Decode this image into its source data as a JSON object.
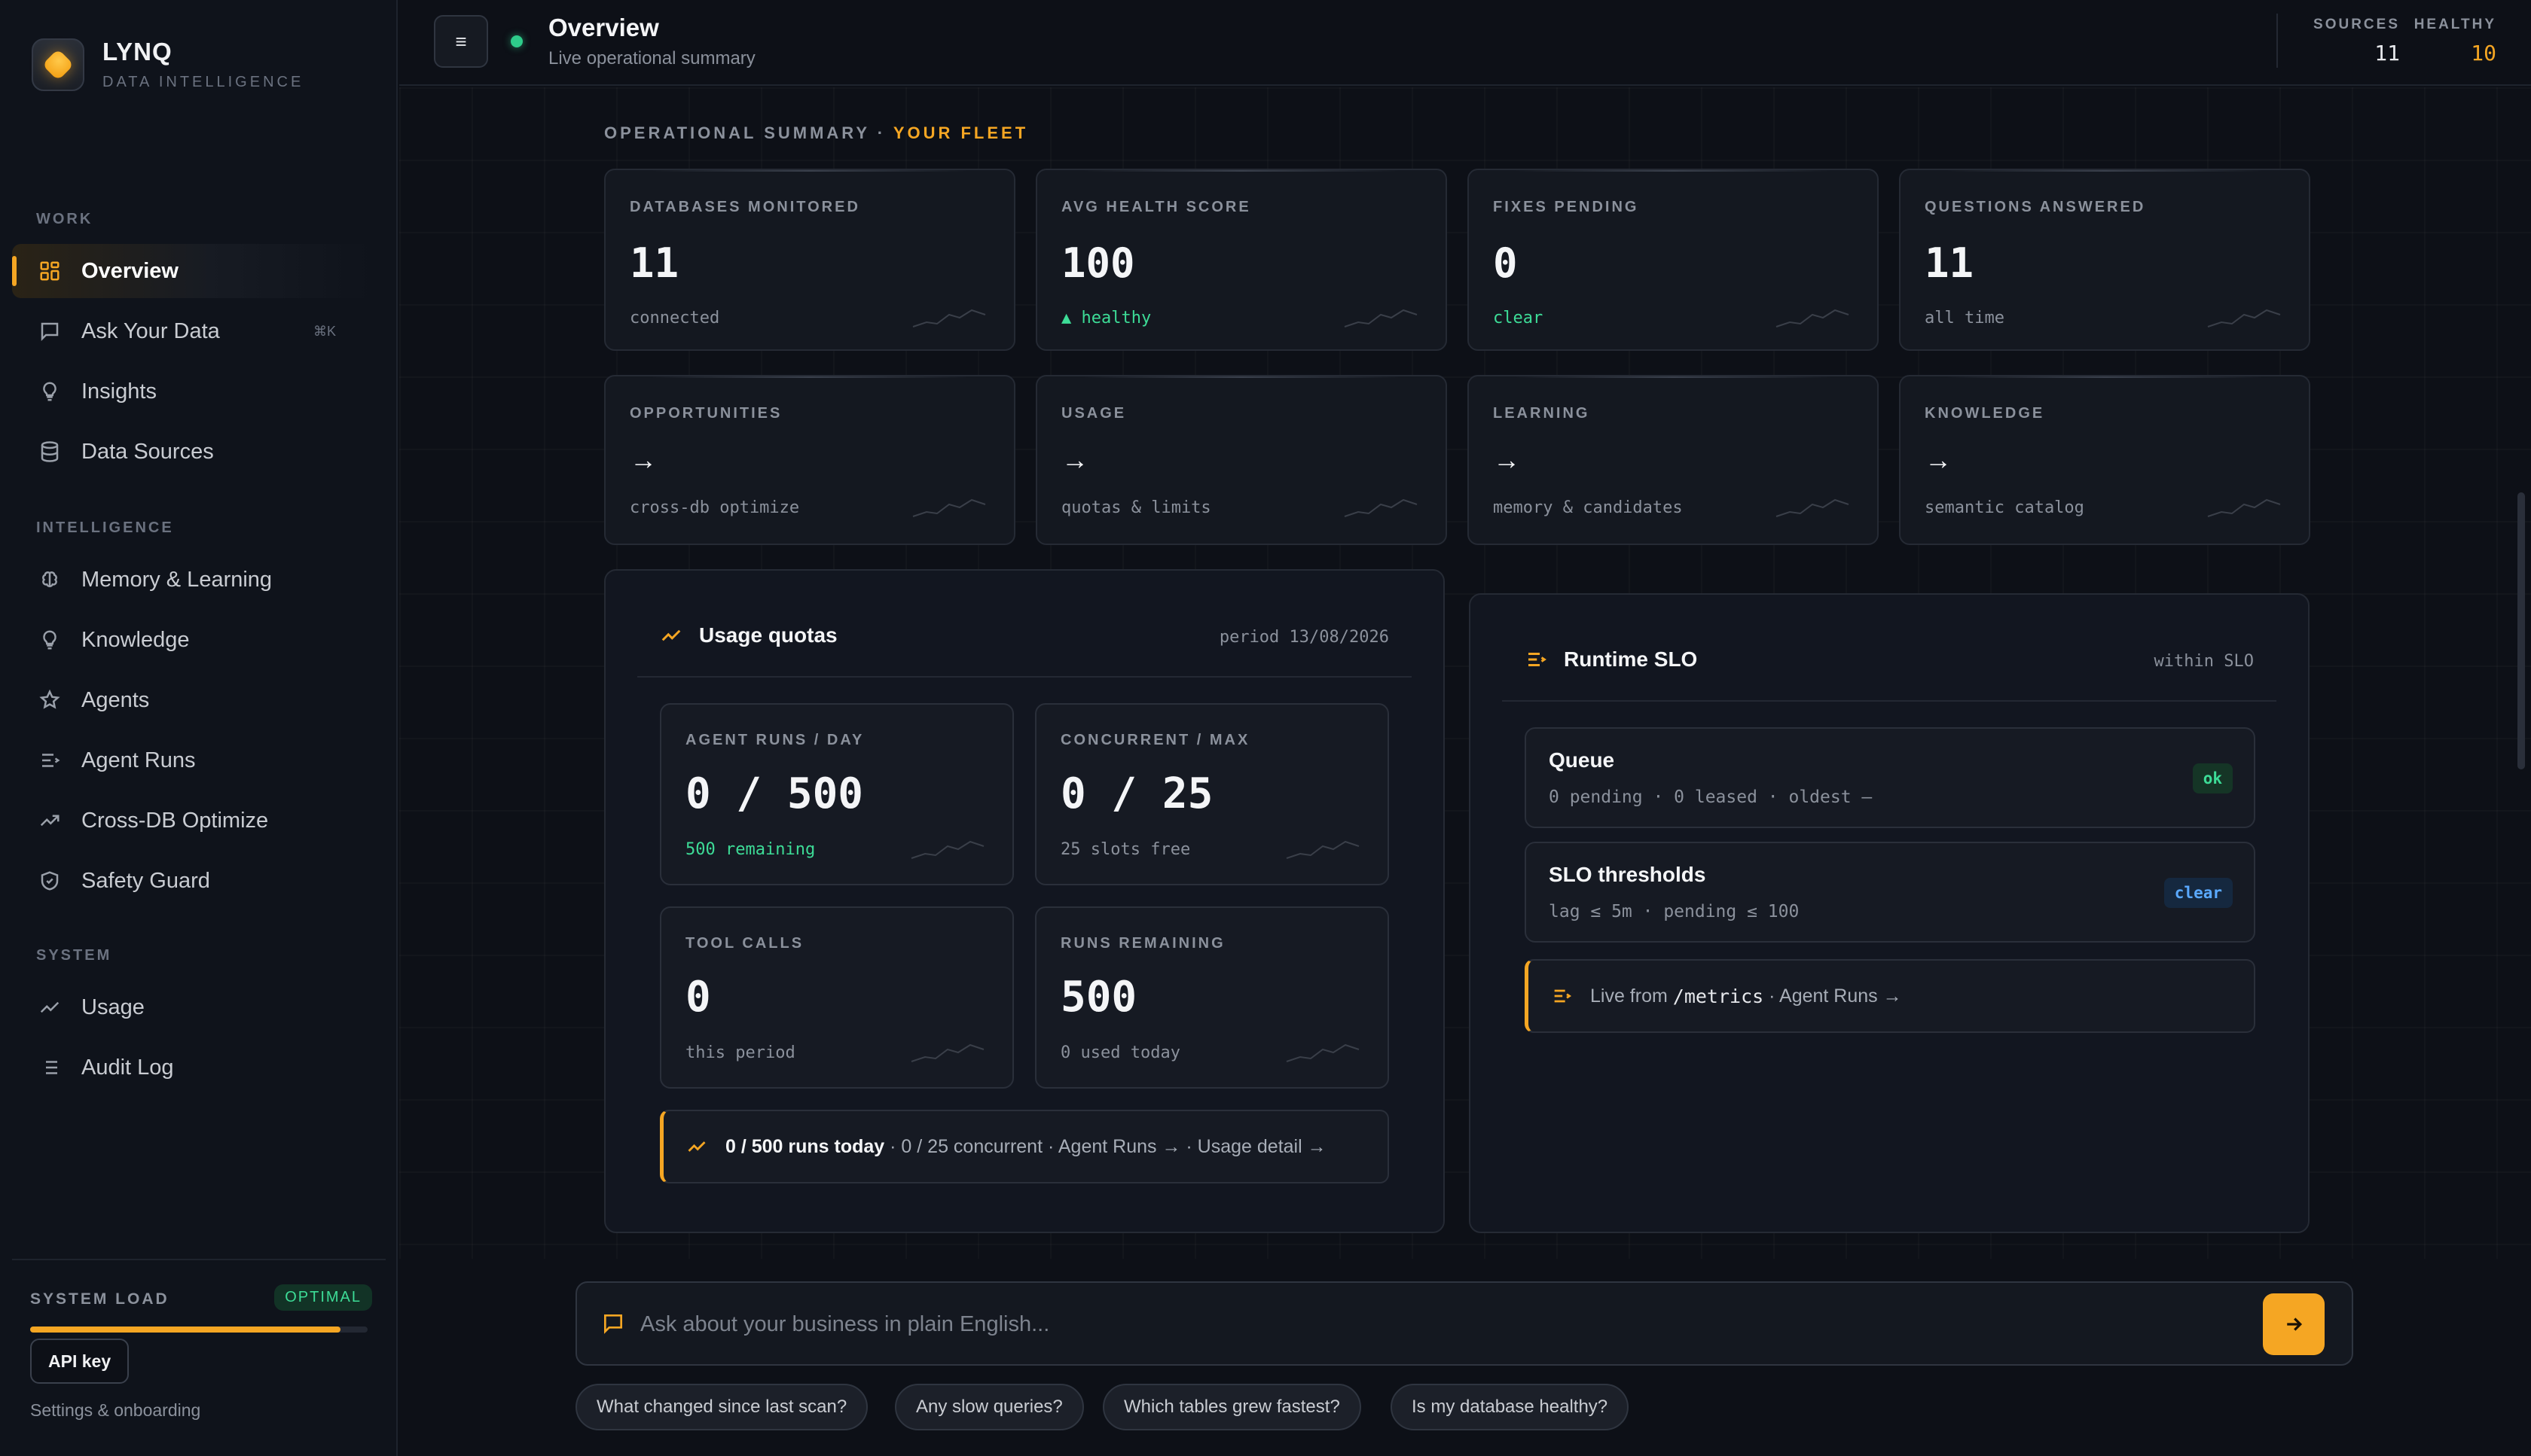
{
  "brand": {
    "name": "LYNQ",
    "subtitle": "DATA INTELLIGENCE"
  },
  "sidebar": {
    "sections": {
      "work": "WORK",
      "intelligence": "INTELLIGENCE",
      "system": "SYSTEM"
    },
    "items": [
      {
        "label": "Overview",
        "icon": "grid-icon",
        "active": true
      },
      {
        "label": "Ask Your Data",
        "icon": "chat-icon",
        "shortcut": "⌘K"
      },
      {
        "label": "Insights",
        "icon": "lightbulb-icon"
      },
      {
        "label": "Data Sources",
        "icon": "database-icon"
      },
      {
        "label": "Memory & Learning",
        "icon": "brain-icon"
      },
      {
        "label": "Knowledge",
        "icon": "lightbulb-icon"
      },
      {
        "label": "Agents",
        "icon": "star-icon"
      },
      {
        "label": "Agent Runs",
        "icon": "list-run-icon"
      },
      {
        "label": "Cross-DB Optimize",
        "icon": "trend-icon"
      },
      {
        "label": "Safety Guard",
        "icon": "shield-icon"
      },
      {
        "label": "Usage",
        "icon": "trend-icon"
      },
      {
        "label": "Audit Log",
        "icon": "list-icon"
      }
    ],
    "system_load": {
      "label": "SYSTEM LOAD",
      "status": "OPTIMAL",
      "level": 0.92
    },
    "api_key": "API key",
    "settings": "Settings & onboarding"
  },
  "header": {
    "title": "Overview",
    "subtitle": "Live operational summary",
    "menu_icon": "≡",
    "stats": [
      {
        "label": "SOURCES",
        "value": "11"
      },
      {
        "label": "HEALTHY",
        "value": "10"
      }
    ]
  },
  "summary": {
    "label": "OPERATIONAL SUMMARY ·",
    "accent": "YOUR FLEET"
  },
  "kpis": [
    {
      "label": "DATABASES MONITORED",
      "value": "11",
      "sub": "connected"
    },
    {
      "label": "AVG HEALTH SCORE",
      "value": "100",
      "sub": "▲ healthy"
    },
    {
      "label": "FIXES PENDING",
      "value": "0",
      "sub": "clear"
    },
    {
      "label": "QUESTIONS ANSWERED",
      "value": "11",
      "sub": "all time"
    }
  ],
  "links": [
    {
      "label": "OPPORTUNITIES",
      "arrow": "→",
      "sub": "cross-db optimize"
    },
    {
      "label": "USAGE",
      "arrow": "→",
      "sub": "quotas & limits"
    },
    {
      "label": "LEARNING",
      "arrow": "→",
      "sub": "memory & candidates"
    },
    {
      "label": "KNOWLEDGE",
      "arrow": "→",
      "sub": "semantic catalog"
    }
  ],
  "usage": {
    "title": "Usage quotas",
    "period": "period 13/08/2026",
    "cards": [
      {
        "label": "AGENT RUNS / DAY",
        "value": "0 / 500",
        "sub": "500 remaining"
      },
      {
        "label": "CONCURRENT / MAX",
        "value": "0 / 25",
        "sub": "25 slots free"
      },
      {
        "label": "TOOL CALLS",
        "value": "0",
        "sub": "this period"
      },
      {
        "label": "RUNS REMAINING",
        "value": "500",
        "sub": "0 used today"
      }
    ],
    "footer": {
      "strong": "0 / 500 runs today",
      "rest": " · 0 / 25 concurrent · Agent Runs → · Usage detail →"
    }
  },
  "slo": {
    "title": "Runtime SLO",
    "status": "within SLO",
    "items": [
      {
        "title": "Queue",
        "sub": "0 pending · 0 leased · oldest —",
        "pill": "ok"
      },
      {
        "title": "SLO thresholds",
        "sub": "lag ≤ 5m · pending ≤ 100",
        "pill": "clear"
      }
    ],
    "live": {
      "prefix": "Live from ",
      "code": "/metrics",
      "suffix": " · Agent Runs →"
    }
  },
  "chat": {
    "placeholder": "Ask about your business in plain English...",
    "suggestions": [
      "What changed since last scan?",
      "Any slow queries?",
      "Which tables grew fastest?",
      "Is my database healthy?"
    ]
  },
  "colors": {
    "accent": "#f5a623",
    "success": "#3ddc97",
    "info": "#5aa9ff",
    "bg": "#0d1017"
  }
}
